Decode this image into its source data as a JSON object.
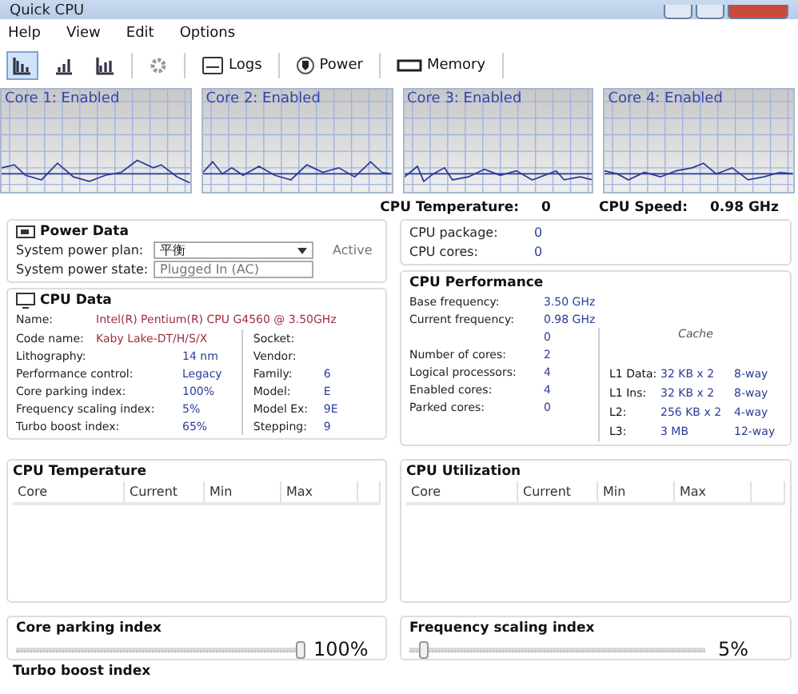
{
  "window": {
    "title": "Quick CPU"
  },
  "menu": [
    "Help",
    "View",
    "Edit",
    "Options"
  ],
  "toolbar": [
    {
      "kind": "icon",
      "selected": true
    },
    {
      "kind": "icon",
      "selected": false
    },
    {
      "kind": "icon",
      "selected": false
    },
    {
      "kind": "sep"
    },
    {
      "kind": "icon",
      "selected": false
    },
    {
      "kind": "sep"
    },
    {
      "kind": "text",
      "label": "Logs"
    },
    {
      "kind": "sep"
    },
    {
      "kind": "text",
      "label": "Power"
    },
    {
      "kind": "sep"
    },
    {
      "kind": "text",
      "label": "Memory"
    },
    {
      "kind": "sep"
    }
  ],
  "cores": [
    "Core 1: Enabled",
    "Core 2: Enabled",
    "Core 3: Enabled",
    "Core 4: Enabled"
  ],
  "summary": [
    {
      "label": "CPU Temperature:",
      "value": "0"
    },
    {
      "label": "CPU Speed:",
      "value": "0.98 GHz"
    }
  ],
  "power_data": {
    "title": "Power Data",
    "plan_label": "System power plan:",
    "plan_value": "平衡",
    "plan_status": "Active",
    "state_label": "System power state:",
    "state_value": "Plugged In (AC)"
  },
  "cpu_data": {
    "title": "CPU Data",
    "name_label": "Name:",
    "name_value": "Intel(R) Pentium(R) CPU G4560 @ 3.50GHz",
    "left": [
      {
        "label": "Code name:",
        "value": "Kaby Lake-DT/H/S/X"
      },
      {
        "label": "Lithography:",
        "value": "14 nm"
      },
      {
        "label": "Performance control:",
        "value": "Legacy"
      },
      {
        "label": "Core parking index:",
        "value": "100%"
      },
      {
        "label": "Frequency scaling index:",
        "value": "5%"
      },
      {
        "label": "Turbo boost index:",
        "value": "65%"
      }
    ],
    "right": [
      {
        "label": "Socket:"
      },
      {
        "label": "Vendor:"
      },
      {
        "label": "Family:",
        "value": "6"
      },
      {
        "label": "Model:",
        "value": "E"
      },
      {
        "label": "Model Ex:",
        "value": "9E"
      },
      {
        "label": "Stepping:",
        "value": "9"
      }
    ]
  },
  "temperatures": [
    {
      "label": "CPU package:",
      "value": "0"
    },
    {
      "label": "CPU cores:",
      "value": "0"
    }
  ],
  "performance": {
    "title": "CPU Performance",
    "rows": [
      {
        "label": "Base frequency:",
        "value": "3.50 GHz"
      },
      {
        "label": "Current frequency:",
        "value": "0.98 GHz"
      },
      {
        "value": "0"
      },
      {
        "label": "Number of cores:",
        "value": "2"
      },
      {
        "label": "Logical processors:",
        "value": "4"
      },
      {
        "label": "Enabled cores:",
        "value": "4"
      },
      {
        "label": "Parked cores:",
        "value": "0"
      }
    ],
    "cache_title": "Cache",
    "cache": [
      {
        "level": "L1 Data:",
        "size": "32 KB x 2",
        "ways": "8-way"
      },
      {
        "level": "L1 Ins:",
        "size": "32 KB x 2",
        "ways": "8-way"
      },
      {
        "level": "L2:",
        "size": "256 KB x 2",
        "ways": "4-way"
      },
      {
        "level": "L3:",
        "size": "3 MB",
        "ways": "12-way"
      }
    ]
  },
  "tables": [
    {
      "title": "CPU Temperature",
      "columns": [
        "Core",
        "Current",
        "Min",
        "Max"
      ]
    },
    {
      "title": "CPU Utilization",
      "columns": [
        "Core",
        "Current",
        "Min",
        "Max"
      ]
    }
  ],
  "sliders": [
    {
      "title": "Core parking index",
      "level": 1.0,
      "reading": "100%"
    },
    {
      "title": "Frequency scaling index",
      "level": 0.05,
      "reading": "5%"
    }
  ],
  "footer": {
    "title": "Turbo boost index"
  }
}
